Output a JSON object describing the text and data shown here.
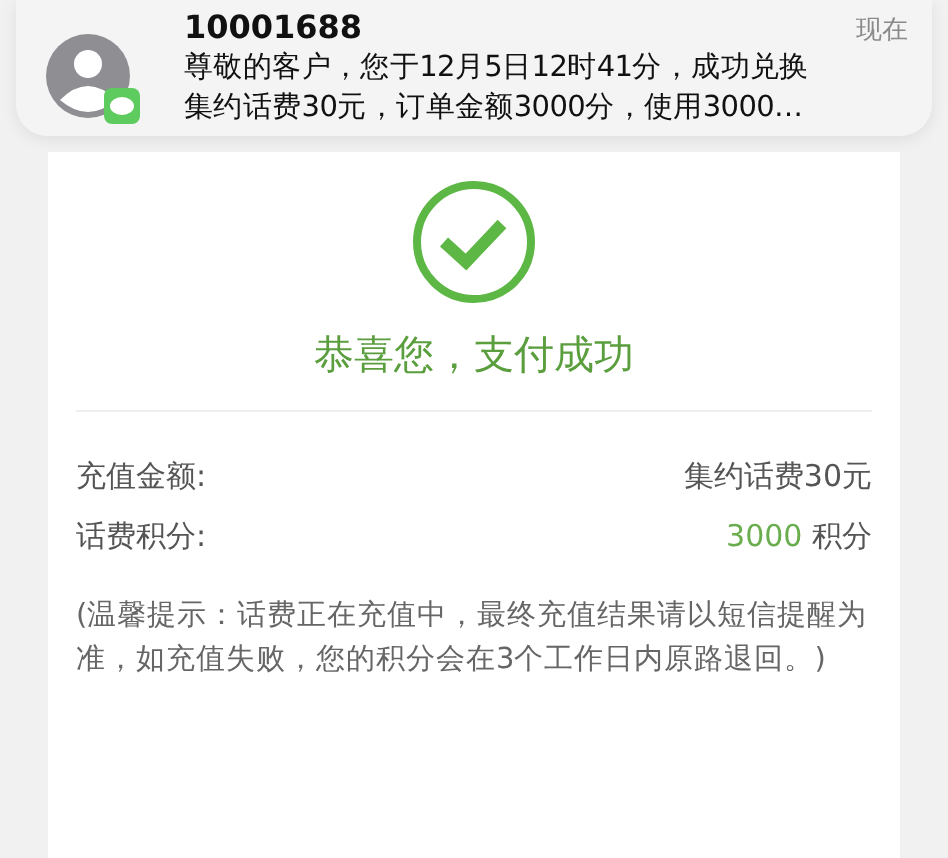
{
  "notification": {
    "sender": "10001688",
    "time": "现在",
    "lines": [
      "尊敬的客户，您于12月5日12时41分，成功兑换",
      "集约话费30元，订单金额3000分，使用3000…"
    ]
  },
  "result": {
    "title": "恭喜您，支付成功"
  },
  "rows": [
    {
      "kind": "text",
      "label": "充值金额:",
      "value": "集约话费30元"
    },
    {
      "kind": "points",
      "label": "话费积分:",
      "value": "3000",
      "unit": "积分"
    }
  ],
  "note": "(温馨提示：话费正在充值中，最终充值结果请以短信提醒为准，如充值失败，您的积分会在3个工作日内原路退回。)"
}
